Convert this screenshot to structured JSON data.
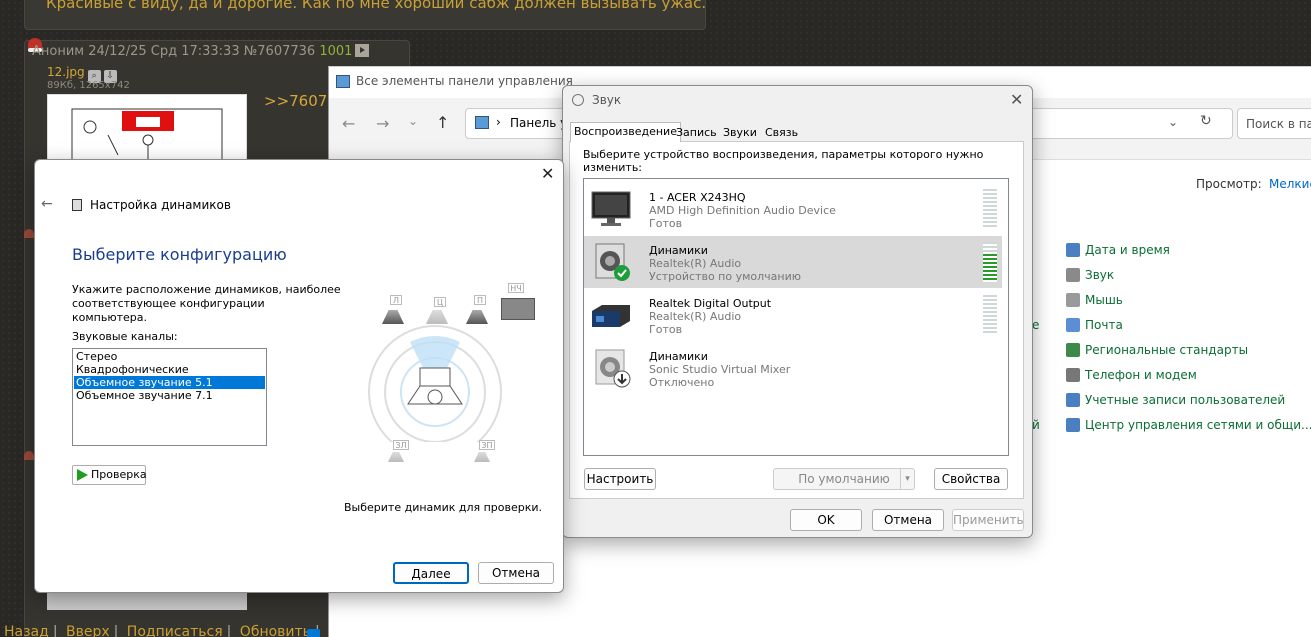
{
  "board": {
    "top_post_text": "Красивые с виду, да и дорогие. Как по мне хороший сабж должен вызывать ужас.",
    "post_author": "Аноним",
    "post_date": "24/12/25 Срд 17:33:33",
    "post_number": "№7607736",
    "post_likes": "1001",
    "file_name": "12.jpg",
    "file_meta": "89Кб, 1265x742",
    "reply_link": ">>7607",
    "bottom_links": [
      "Назад",
      "Вверх",
      "Подписаться",
      "Обновить"
    ]
  },
  "control_panel": {
    "title": "Все элементы панели управления",
    "address": "Панель у",
    "search_placeholder": "Поиск в пан",
    "view_label": "Просмотр:",
    "view_value": "Мелкие",
    "items": [
      {
        "label": "Дата и время",
        "icon": "calendar-clock-icon",
        "color": "#4a7fc1"
      },
      {
        "label": "Звук",
        "icon": "speaker-icon",
        "color": "#8a8a8a"
      },
      {
        "label": "Мышь",
        "icon": "mouse-icon",
        "color": "#9a9a9a"
      },
      {
        "label": "Почта",
        "icon": "mail-icon",
        "color": "#5a8fd6"
      },
      {
        "label": "Региональные стандарты",
        "icon": "globe-icon",
        "color": "#3b8a4a"
      },
      {
        "label": "Телефон и модем",
        "icon": "phone-icon",
        "color": "#777777"
      },
      {
        "label": "Учетные записи пользователей",
        "icon": "users-icon",
        "color": "#4a7fc1"
      },
      {
        "label": "Центр управления сетями и общи...",
        "icon": "network-icon",
        "color": "#4a7fc1"
      }
    ]
  },
  "sound_dialog": {
    "title": "Звук",
    "tabs": [
      "Воспроизведение",
      "Запись",
      "Звуки",
      "Связь"
    ],
    "description": "Выберите устройство воспроизведения, параметры которого нужно изменить:",
    "devices": [
      {
        "name": "1 - ACER X243HQ",
        "driver": "AMD High Definition Audio Device",
        "status": "Готов",
        "icon": "monitor-icon",
        "level": 0
      },
      {
        "name": "Динамики",
        "driver": "Realtek(R) Audio",
        "status": "Устройство по умолчанию",
        "icon": "speaker-default-icon",
        "level": 0.7
      },
      {
        "name": "Realtek Digital Output",
        "driver": "Realtek(R) Audio",
        "status": "Готов",
        "icon": "digital-output-icon",
        "level": 0
      },
      {
        "name": "Динамики",
        "driver": "Sonic Studio Virtual Mixer",
        "status": "Отключено",
        "icon": "speaker-disabled-icon",
        "level": null
      }
    ],
    "buttons": {
      "configure": "Настроить",
      "set_default": "По умолчанию",
      "properties": "Свойства",
      "ok": "OK",
      "cancel": "Отмена",
      "apply": "Применить"
    }
  },
  "speaker_setup": {
    "title": "Настройка динамиков",
    "heading": "Выберите конфигурацию",
    "instruction": "Укажите расположение динамиков, наиболее соответствующее конфигурации компьютера.",
    "channels_label": "Звуковые каналы:",
    "channels": [
      "Стерео",
      "Квадрофонические",
      "Объемное звучание 5.1",
      "Объемное звучание 7.1"
    ],
    "selected_channel": "Объемное звучание 5.1",
    "test_button": "Проверка",
    "hint": "Выберите динамик для проверки.",
    "speaker_labels": {
      "front_left": "Л",
      "center": "Ц",
      "front_right": "П",
      "sub": "НЧ",
      "rear_left": "ЗЛ",
      "rear_right": "ЗП"
    },
    "next_button": "Далее",
    "cancel_button": "Отмена"
  }
}
